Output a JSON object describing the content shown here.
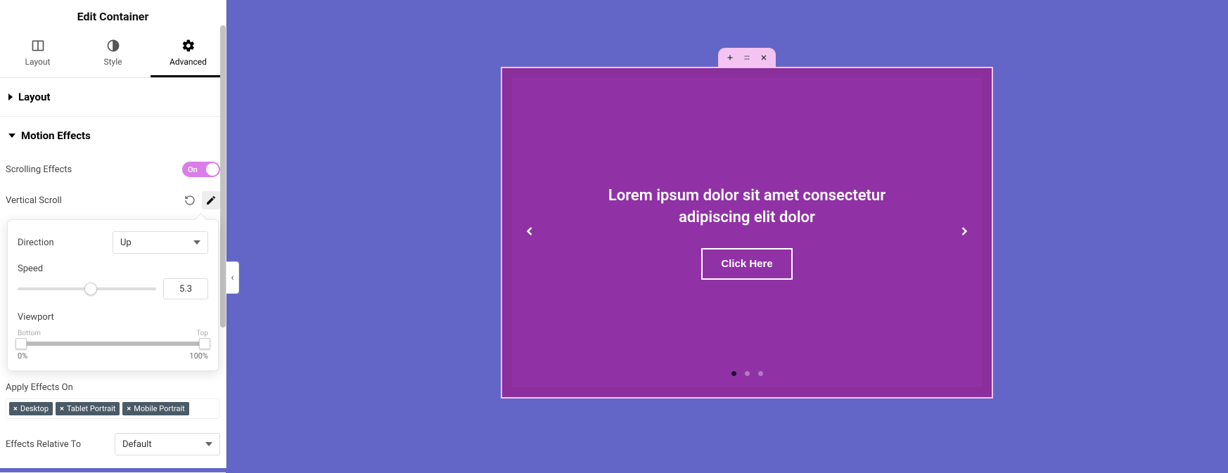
{
  "panel": {
    "title": "Edit Container",
    "tabs": {
      "layout": "Layout",
      "style": "Style",
      "advanced": "Advanced"
    },
    "sections": {
      "layout_label": "Layout",
      "motion_label": "Motion Effects"
    },
    "motion": {
      "scrolling_effects_label": "Scrolling Effects",
      "scrolling_effects_on": "On",
      "vertical_scroll_label": "Vertical Scroll",
      "popout": {
        "direction_label": "Direction",
        "direction_value": "Up",
        "speed_label": "Speed",
        "speed_value": "5.3",
        "speed_min": 0,
        "speed_max": 10,
        "viewport_label": "Viewport",
        "viewport_bottom_label": "Bottom",
        "viewport_top_label": "Top",
        "viewport_bottom_value": "0%",
        "viewport_top_value": "100%"
      },
      "apply_on_label": "Apply Effects On",
      "apply_on_tags": [
        "Desktop",
        "Tablet Portrait",
        "Mobile Portrait"
      ],
      "relative_label": "Effects Relative To",
      "relative_value": "Default"
    }
  },
  "canvas": {
    "slide_title": "Lorem ipsum dolor sit amet consectetur adipiscing elit dolor",
    "slide_button": "Click Here"
  }
}
